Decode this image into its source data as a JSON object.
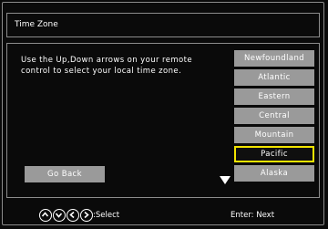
{
  "title": "Time Zone",
  "instructions": "Use the Up,Down arrows on your remote control to select your local time zone.",
  "time_zones": [
    "Newfoundland",
    "Atlantic",
    "Eastern",
    "Central",
    "Mountain",
    "Pacific",
    "Alaska"
  ],
  "selected_time_zone": "Pacific",
  "go_back_label": "Go Back",
  "footer": {
    "select_label": ":Select",
    "enter_label": "Enter: Next"
  },
  "colors": {
    "background": "#0a0a0a",
    "button": "#9a9a9a",
    "highlight_border": "#f2e400",
    "border": "#8c8c8c"
  }
}
